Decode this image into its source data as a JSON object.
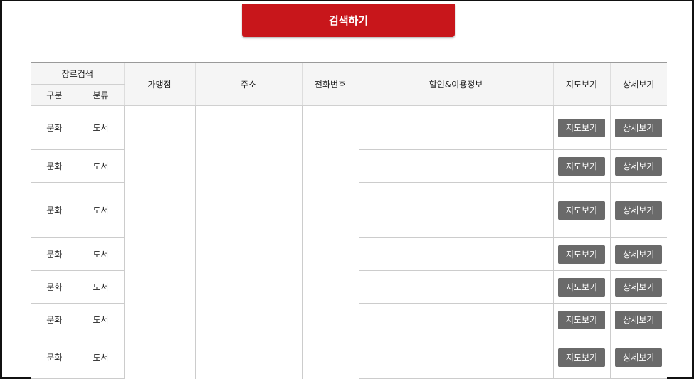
{
  "search_button": "검색하기",
  "headers": {
    "genre_search": "장르검색",
    "category": "구분",
    "classification": "분류",
    "store": "가맹점",
    "address": "주소",
    "phone": "전화번호",
    "discount_info": "할인&이용정보",
    "map_view": "지도보기",
    "detail_view": "상세보기"
  },
  "rows": [
    {
      "category": "문화",
      "classification": "도서",
      "map_button": "지도보기",
      "detail_button": "상세보기"
    },
    {
      "category": "문화",
      "classification": "도서",
      "map_button": "지도보기",
      "detail_button": "상세보기"
    },
    {
      "category": "문화",
      "classification": "도서",
      "map_button": "지도보기",
      "detail_button": "상세보기"
    },
    {
      "category": "문화",
      "classification": "도서",
      "map_button": "지도보기",
      "detail_button": "상세보기"
    },
    {
      "category": "문화",
      "classification": "도서",
      "map_button": "지도보기",
      "detail_button": "상세보기"
    },
    {
      "category": "문화",
      "classification": "도서",
      "map_button": "지도보기",
      "detail_button": "상세보기"
    },
    {
      "category": "문화",
      "classification": "도서",
      "map_button": "지도보기",
      "detail_button": "상세보기"
    }
  ],
  "colors": {
    "accent": "#c8161b",
    "button": "#6a6a6a",
    "header_bg": "#f5f5f5"
  }
}
